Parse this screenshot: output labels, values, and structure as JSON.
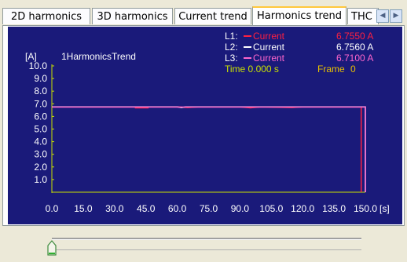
{
  "tabs": [
    {
      "label": "2D harmonics",
      "active": false
    },
    {
      "label": "3D harmonics",
      "active": false
    },
    {
      "label": "Current trend",
      "active": false
    },
    {
      "label": "Harmonics trend",
      "active": true
    },
    {
      "label": "THC",
      "active": false
    }
  ],
  "chart": {
    "unit_label": "[A]",
    "title": "1HarmonicsTrend",
    "x_unit": "[s]",
    "legend": [
      {
        "line": "L1:",
        "name": "Current",
        "value": "6.7550 A",
        "color": "#ff2040"
      },
      {
        "line": "L2:",
        "name": "Current",
        "value": "6.7560 A",
        "color": "#ffffff"
      },
      {
        "line": "L3:",
        "name": "Current",
        "value": "6.7100 A",
        "color": "#ff66cc"
      }
    ],
    "time_label": "Time 0.000 s",
    "frame_label": "Frame",
    "frame_value": "0",
    "y_ticks": [
      "10.0",
      "9.0",
      "8.0",
      "7.0",
      "6.0",
      "5.0",
      "4.0",
      "3.0",
      "2.0",
      "1.0"
    ],
    "x_ticks": [
      "0.0",
      "15.0",
      "30.0",
      "45.0",
      "60.0",
      "75.0",
      "90.0",
      "105.0",
      "120.0",
      "135.0",
      "150.0"
    ]
  },
  "chart_data": {
    "type": "line",
    "title": "1HarmonicsTrend",
    "xlabel": "[s]",
    "ylabel": "[A]",
    "xlim": [
      0,
      150
    ],
    "ylim": [
      0,
      10
    ],
    "series": [
      {
        "name": "Current",
        "values": [
          [
            0,
            6.76
          ],
          [
            40,
            6.76
          ],
          [
            40,
            6.68
          ],
          [
            46,
            6.68
          ],
          [
            46,
            6.76
          ],
          [
            60,
            6.76
          ],
          [
            65,
            6.7
          ],
          [
            70,
            6.76
          ],
          [
            90,
            6.76
          ],
          [
            95,
            6.68
          ],
          [
            100,
            6.76
          ],
          [
            115,
            6.7
          ],
          [
            120,
            6.76
          ],
          [
            148,
            6.76
          ],
          [
            148,
            0
          ]
        ]
      },
      {
        "name": "Current",
        "values": [
          [
            0,
            6.76
          ],
          [
            60,
            6.76
          ],
          [
            62,
            6.7
          ],
          [
            64,
            6.76
          ],
          [
            150,
            6.76
          ],
          [
            150,
            0
          ]
        ]
      },
      {
        "name": "Current",
        "values": [
          [
            0,
            6.74
          ],
          [
            150,
            6.74
          ],
          [
            150,
            0
          ]
        ]
      }
    ]
  },
  "slider": {
    "position": 0
  }
}
